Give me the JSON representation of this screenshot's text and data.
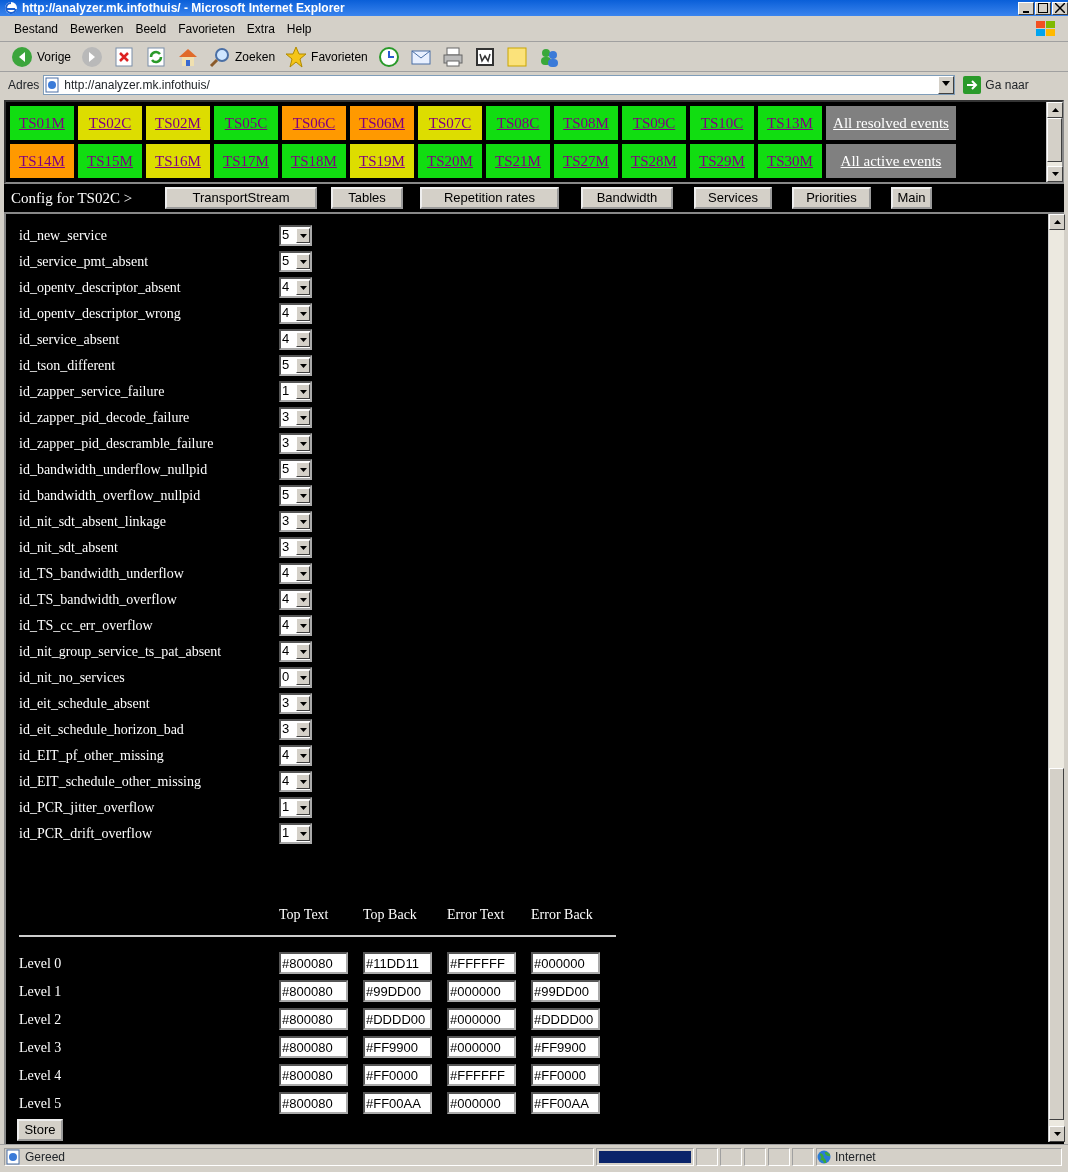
{
  "window": {
    "title": "http://analyzer.mk.infothuis/ - Microsoft Internet Explorer"
  },
  "menu": [
    "Bestand",
    "Bewerken",
    "Beeld",
    "Favorieten",
    "Extra",
    "Help"
  ],
  "toolbar": [
    {
      "kind": "back",
      "label": "Vorige"
    },
    {
      "kind": "forward"
    },
    {
      "kind": "stop"
    },
    {
      "kind": "refresh"
    },
    {
      "kind": "home"
    },
    {
      "kind": "search",
      "label": "Zoeken"
    },
    {
      "kind": "favorites",
      "label": "Favorieten"
    },
    {
      "kind": "history"
    },
    {
      "kind": "mail"
    },
    {
      "kind": "print"
    },
    {
      "kind": "edit"
    },
    {
      "kind": "note"
    },
    {
      "kind": "people"
    }
  ],
  "address": {
    "label": "Adres",
    "url": "http://analyzer.mk.infothuis/",
    "go": "Ga naar"
  },
  "stream_rows": [
    {
      "tiles": [
        {
          "label": "TS01M",
          "color": "#11dd11"
        },
        {
          "label": "TS02C",
          "color": "#dddd00"
        },
        {
          "label": "TS02M",
          "color": "#dddd00"
        },
        {
          "label": "TS05C",
          "color": "#11dd11"
        },
        {
          "label": "TS06C",
          "color": "#ff9900"
        },
        {
          "label": "TS06M",
          "color": "#ff9900"
        },
        {
          "label": "TS07C",
          "color": "#dddd00"
        },
        {
          "label": "TS08C",
          "color": "#11dd11"
        },
        {
          "label": "TS08M",
          "color": "#11dd11"
        },
        {
          "label": "TS09C",
          "color": "#11dd11"
        },
        {
          "label": "TS10C",
          "color": "#11dd11"
        },
        {
          "label": "TS13M",
          "color": "#11dd11"
        }
      ],
      "events": "All resolved events"
    },
    {
      "tiles": [
        {
          "label": "TS14M",
          "color": "#ff9900"
        },
        {
          "label": "TS15M",
          "color": "#11dd11"
        },
        {
          "label": "TS16M",
          "color": "#dddd00"
        },
        {
          "label": "TS17M",
          "color": "#11dd11"
        },
        {
          "label": "TS18M",
          "color": "#11dd11"
        },
        {
          "label": "TS19M",
          "color": "#dddd00"
        },
        {
          "label": "TS20M",
          "color": "#11dd11"
        },
        {
          "label": "TS21M",
          "color": "#11dd11"
        },
        {
          "label": "TS27M",
          "color": "#11dd11"
        },
        {
          "label": "TS28M",
          "color": "#11dd11"
        },
        {
          "label": "TS29M",
          "color": "#11dd11"
        },
        {
          "label": "TS30M",
          "color": "#11dd11"
        }
      ],
      "events": "All active events"
    }
  ],
  "config_bar": {
    "label": "Config for TS02C >",
    "buttons": [
      "TransportStream",
      "Tables",
      "Repetition rates",
      "Bandwidth",
      "Services",
      "Priorities",
      "Main"
    ]
  },
  "settings": [
    {
      "name": "id_new_service",
      "value": "5"
    },
    {
      "name": "id_service_pmt_absent",
      "value": "5"
    },
    {
      "name": "id_opentv_descriptor_absent",
      "value": "4"
    },
    {
      "name": "id_opentv_descriptor_wrong",
      "value": "4"
    },
    {
      "name": "id_service_absent",
      "value": "4"
    },
    {
      "name": "id_tson_different",
      "value": "5"
    },
    {
      "name": "id_zapper_service_failure",
      "value": "1"
    },
    {
      "name": "id_zapper_pid_decode_failure",
      "value": "3"
    },
    {
      "name": "id_zapper_pid_descramble_failure",
      "value": "3"
    },
    {
      "name": "id_bandwidth_underflow_nullpid",
      "value": "5"
    },
    {
      "name": "id_bandwidth_overflow_nullpid",
      "value": "5"
    },
    {
      "name": "id_nit_sdt_absent_linkage",
      "value": "3"
    },
    {
      "name": "id_nit_sdt_absent",
      "value": "3"
    },
    {
      "name": "id_TS_bandwidth_underflow",
      "value": "4"
    },
    {
      "name": "id_TS_bandwidth_overflow",
      "value": "4"
    },
    {
      "name": "id_TS_cc_err_overflow",
      "value": "4"
    },
    {
      "name": "id_nit_group_service_ts_pat_absent",
      "value": "4"
    },
    {
      "name": "id_nit_no_services",
      "value": "0"
    },
    {
      "name": "id_eit_schedule_absent",
      "value": "3"
    },
    {
      "name": "id_eit_schedule_horizon_bad",
      "value": "3"
    },
    {
      "name": "id_EIT_pf_other_missing",
      "value": "4"
    },
    {
      "name": "id_EIT_schedule_other_missing",
      "value": "4"
    },
    {
      "name": "id_PCR_jitter_overflow",
      "value": "1"
    },
    {
      "name": "id_PCR_drift_overflow",
      "value": "1"
    }
  ],
  "levels": {
    "columns": [
      "Top Text",
      "Top Back",
      "Error Text",
      "Error Back"
    ],
    "rows": [
      {
        "label": "Level 0",
        "values": [
          "#800080",
          "#11DD11",
          "#FFFFFF",
          "#000000"
        ]
      },
      {
        "label": "Level 1",
        "values": [
          "#800080",
          "#99DD00",
          "#000000",
          "#99DD00"
        ]
      },
      {
        "label": "Level 2",
        "values": [
          "#800080",
          "#DDDD00",
          "#000000",
          "#DDDD00"
        ]
      },
      {
        "label": "Level 3",
        "values": [
          "#800080",
          "#FF9900",
          "#000000",
          "#FF9900"
        ]
      },
      {
        "label": "Level 4",
        "values": [
          "#800080",
          "#FF0000",
          "#FFFFFF",
          "#FF0000"
        ]
      },
      {
        "label": "Level 5",
        "values": [
          "#800080",
          "#FF00AA",
          "#000000",
          "#FF00AA"
        ]
      }
    ],
    "button": "Store"
  },
  "status_bar": {
    "text": "Gereed",
    "progress": {
      "level": 1
    },
    "zone": "Internet"
  }
}
